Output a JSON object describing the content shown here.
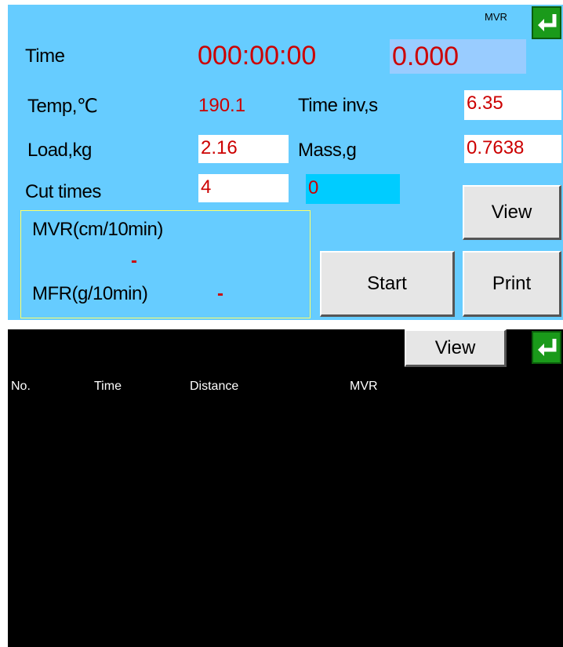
{
  "top": {
    "mode_label": "MVR",
    "time": {
      "label": "Time",
      "value": "000:00:00",
      "value2": "0.000"
    },
    "temp": {
      "label": "Temp,℃",
      "value": "190.1"
    },
    "time_inv": {
      "label": "Time inv,s",
      "value": "6.35"
    },
    "load": {
      "label": "Load,kg",
      "value": "2.16"
    },
    "mass": {
      "label": "Mass,g",
      "value": "0.7638"
    },
    "cut_times": {
      "label": "Cut times",
      "value": "4",
      "counter": "0"
    },
    "results": {
      "mvr_label": "MVR(cm/10min)",
      "mvr_value": "-",
      "mfr_label": "MFR(g/10min)",
      "mfr_value": "-"
    },
    "view_label": "View",
    "start_label": "Start",
    "print_label": "Print"
  },
  "bottom": {
    "view_label": "View",
    "columns": [
      "No.",
      "Time",
      "Distance",
      "MVR"
    ]
  },
  "colors": {
    "panel_bg": "#66ccff",
    "value_red": "#cc0000",
    "counter_bg": "#00ccff",
    "enter_green": "#1a9a1a",
    "results_border": "#ffff66"
  },
  "icons": {
    "enter": "enter-arrow-icon"
  }
}
